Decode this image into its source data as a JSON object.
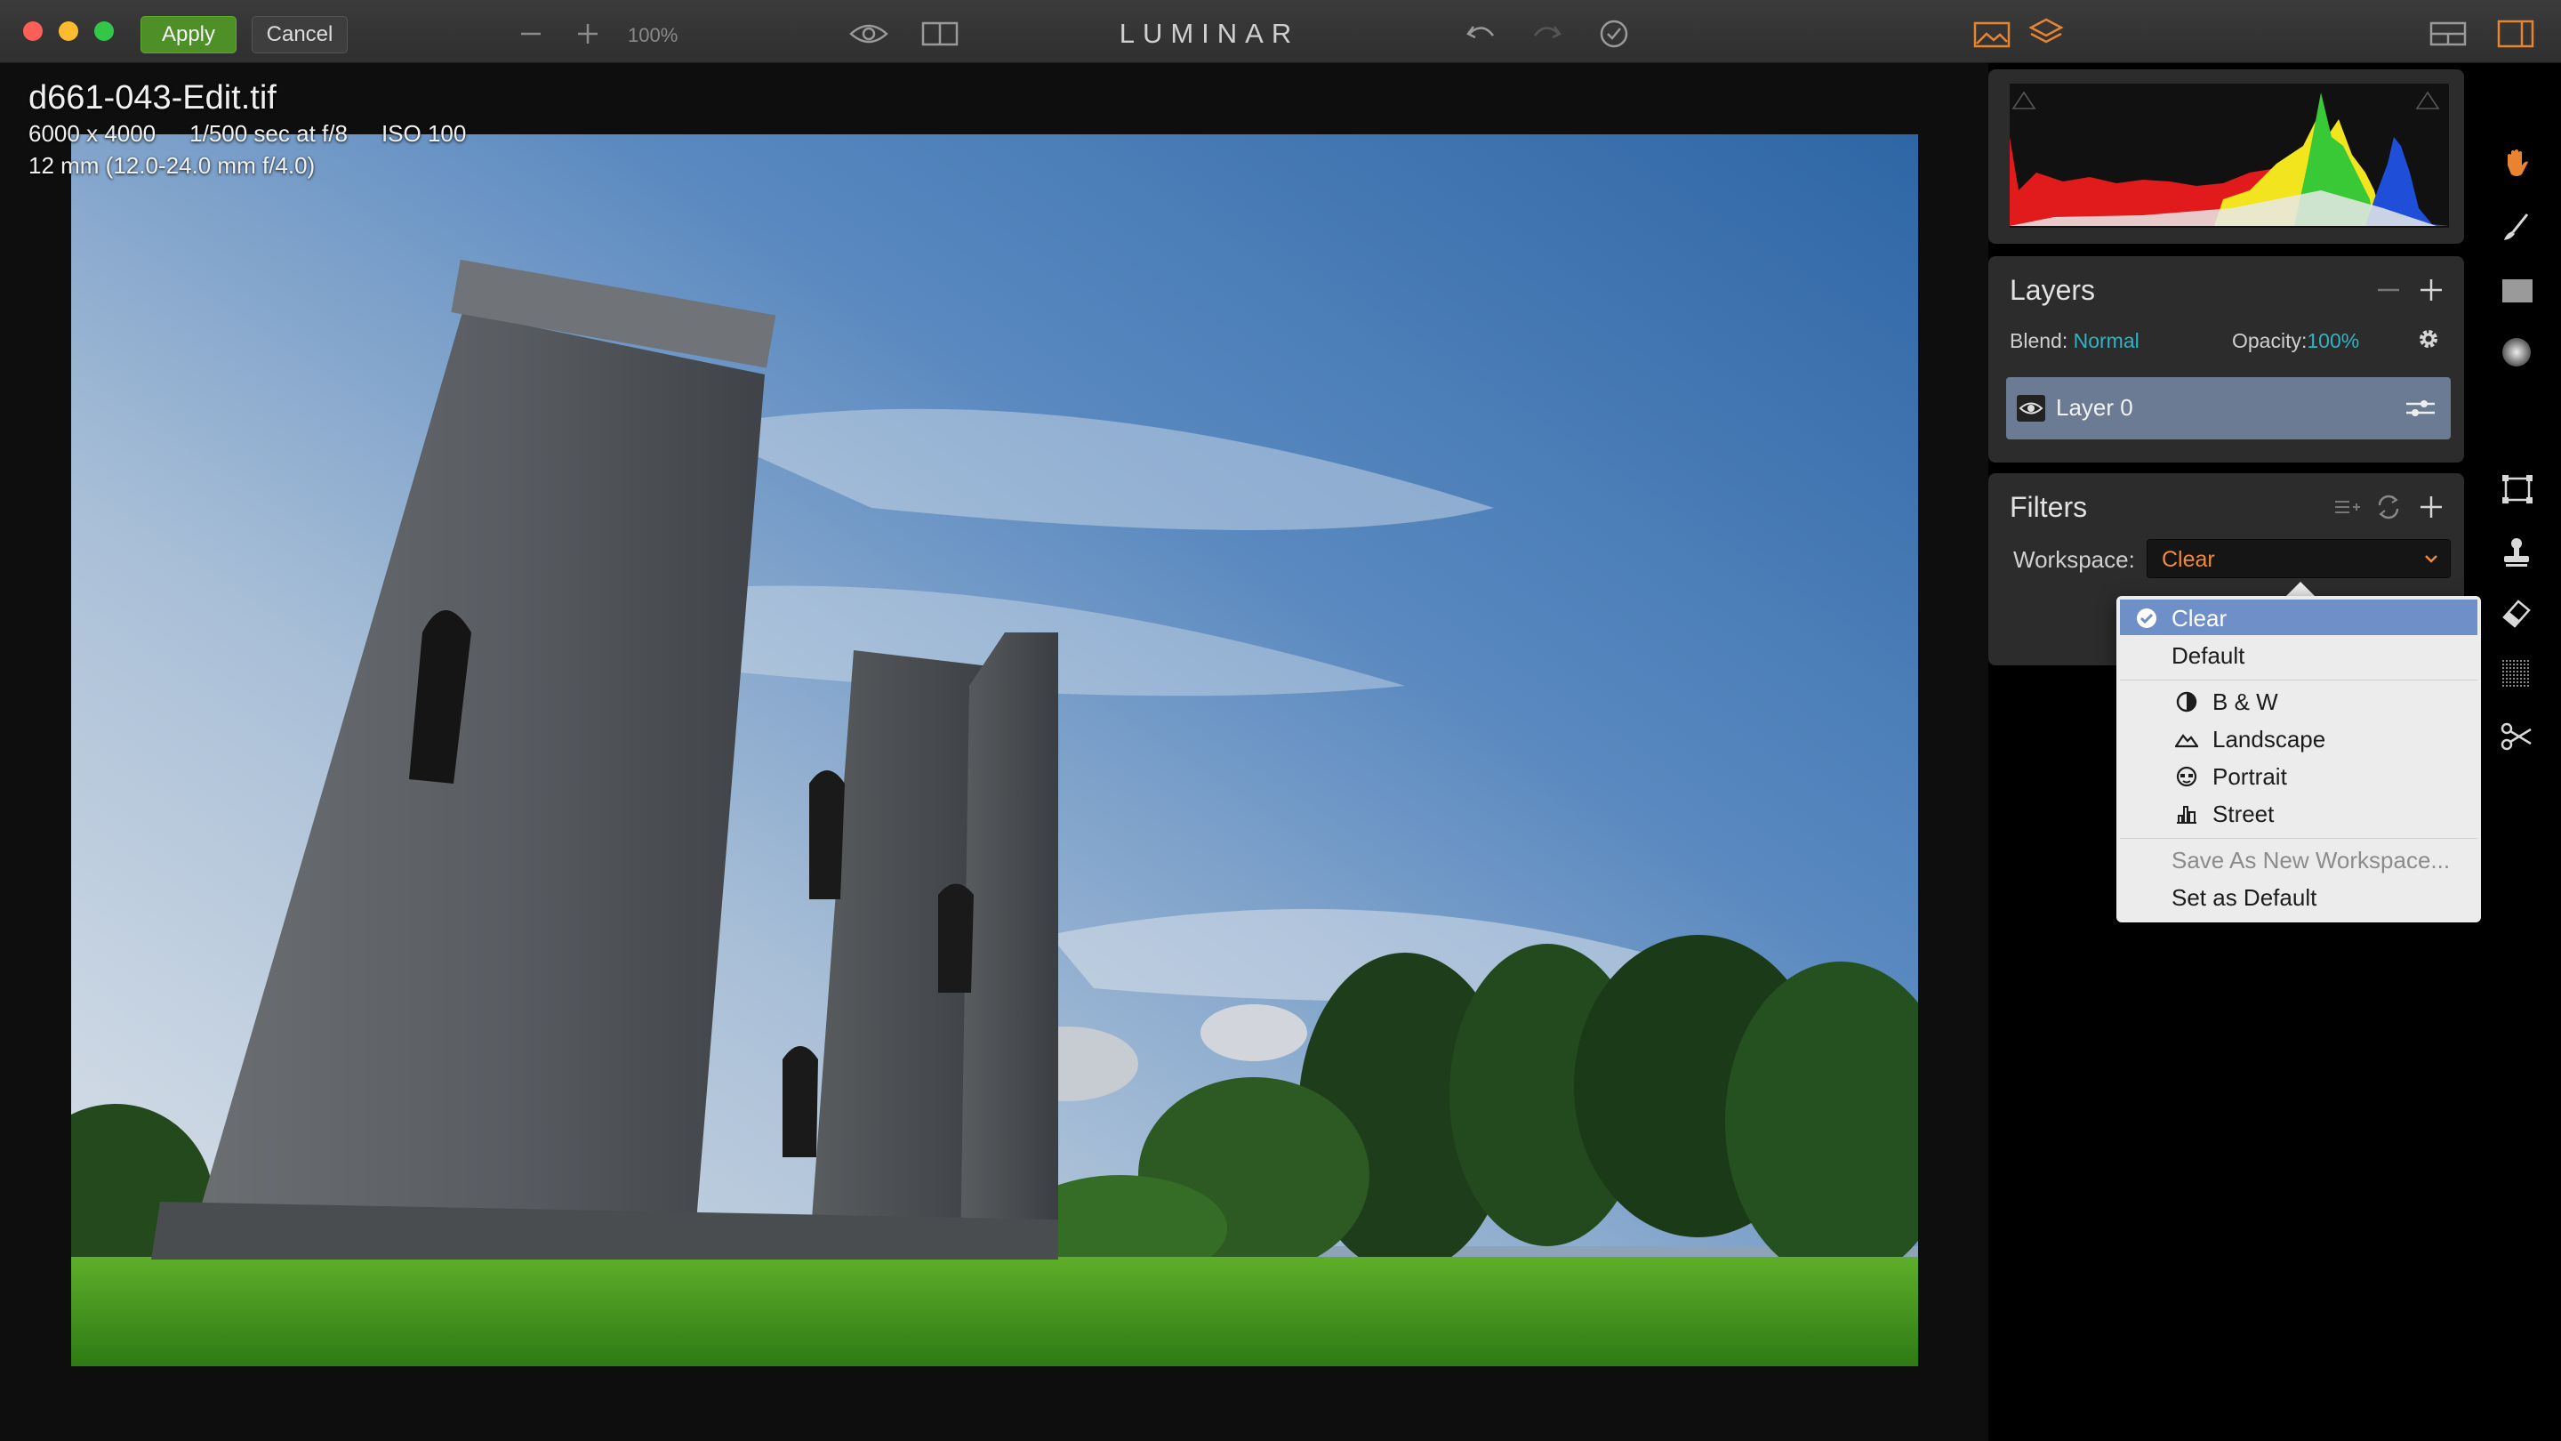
{
  "titlebar": {
    "apply_label": "Apply",
    "cancel_label": "Cancel",
    "zoom_level": "100%",
    "app_name": "LUMINAR"
  },
  "photo": {
    "file_name": "d661-043-Edit.tif",
    "dimensions": "6000 x 4000",
    "shutter": "1/500 sec at f/8",
    "iso": "ISO 100",
    "lens": "12 mm (12.0-24.0 mm f/4.0)"
  },
  "layers": {
    "title": "Layers",
    "blend_label": "Blend:",
    "blend_value": "Normal",
    "opacity_label": "Opacity:",
    "opacity_value": "100%",
    "items": [
      {
        "name": "Layer 0"
      }
    ]
  },
  "filters": {
    "title": "Filters",
    "workspace_label": "Workspace:",
    "workspace_value": "Clear"
  },
  "workspace_menu": {
    "items": [
      {
        "label": "Clear",
        "selected": true
      },
      {
        "label": "Default"
      },
      {
        "label": "B & W",
        "icon": "contrast-icon"
      },
      {
        "label": "Landscape",
        "icon": "mountain-icon"
      },
      {
        "label": "Portrait",
        "icon": "face-icon"
      },
      {
        "label": "Street",
        "icon": "city-icon"
      },
      {
        "label": "Save As New Workspace...",
        "disabled": true
      },
      {
        "label": "Set as Default"
      }
    ]
  },
  "colors": {
    "accent_orange": "#f0893a",
    "teal": "#31b3c4",
    "apply_green": "#4f8f28",
    "layer_selected": "#6b7b93",
    "menu_selected": "#6f8fc8"
  }
}
